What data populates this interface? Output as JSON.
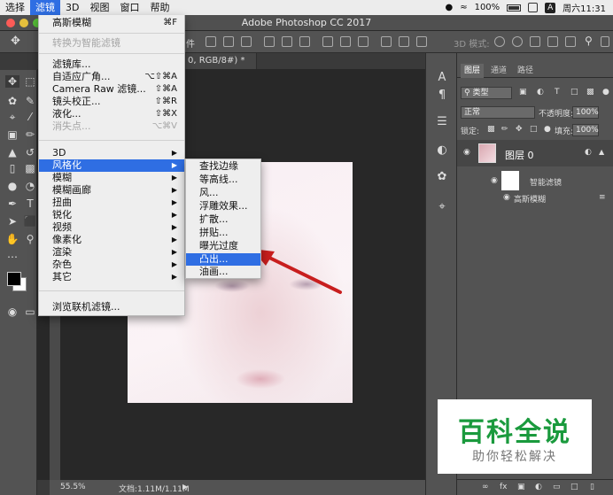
{
  "menubar": {
    "items": [
      "选择",
      "滤镜",
      "3D",
      "视图",
      "窗口",
      "帮助"
    ],
    "status": {
      "battery": "100%",
      "time": "周六11:31",
      "input_method": "A"
    }
  },
  "window": {
    "title": "Adobe Photoshop CC 2017"
  },
  "options_bar": {
    "mode_label": "3D 模式:",
    "partial_label": "件"
  },
  "document": {
    "tab_label": "0, RGB/8#) *",
    "zoom": "55.5%",
    "doc_info": "文档:1.11M/1.11M"
  },
  "filter_menu": {
    "items": [
      {
        "label": "高斯模糊",
        "shortcut": "⌘F"
      },
      {
        "label": "转换为智能滤镜",
        "disabled": true
      },
      {
        "label": "滤镜库..."
      },
      {
        "label": "自适应广角...",
        "shortcut": "⌥⇧⌘A"
      },
      {
        "label": "Camera Raw 滤镜...",
        "shortcut": "⇧⌘A"
      },
      {
        "label": "镜头校正...",
        "shortcut": "⇧⌘R"
      },
      {
        "label": "液化...",
        "shortcut": "⇧⌘X"
      },
      {
        "label": "消失点...",
        "shortcut": "⌥⌘V",
        "disabled": true
      },
      {
        "label": "3D"
      },
      {
        "label": "风格化"
      },
      {
        "label": "模糊"
      },
      {
        "label": "模糊画廊"
      },
      {
        "label": "扭曲"
      },
      {
        "label": "锐化"
      },
      {
        "label": "视频"
      },
      {
        "label": "像素化"
      },
      {
        "label": "渲染"
      },
      {
        "label": "杂色"
      },
      {
        "label": "其它"
      },
      {
        "label": "浏览联机滤镜..."
      }
    ]
  },
  "stylize_submenu": {
    "items": [
      "查找边缘",
      "等高线...",
      "风...",
      "浮雕效果...",
      "扩散...",
      "拼贴...",
      "曝光过度",
      "凸出...",
      "油画..."
    ]
  },
  "layers_panel": {
    "tabs": [
      "图层",
      "通道",
      "路径"
    ],
    "kind_filter": "类型",
    "blend_mode": "正常",
    "opacity_label": "不透明度:",
    "opacity_value": "100%",
    "lock_label": "锁定:",
    "fill_label": "填充:",
    "fill_value": "100%",
    "layer_name": "图层 0",
    "smart_filter_label": "智能滤镜",
    "filter_name": "高斯模糊"
  },
  "watermark": {
    "title": "百科全说",
    "subtitle": "助你轻松解决"
  },
  "colors": {
    "menu_highlight": "#2f6ee3",
    "panel_bg": "#535353",
    "canvas_bg": "#282828",
    "watermark_green": "#1a9a3d"
  }
}
